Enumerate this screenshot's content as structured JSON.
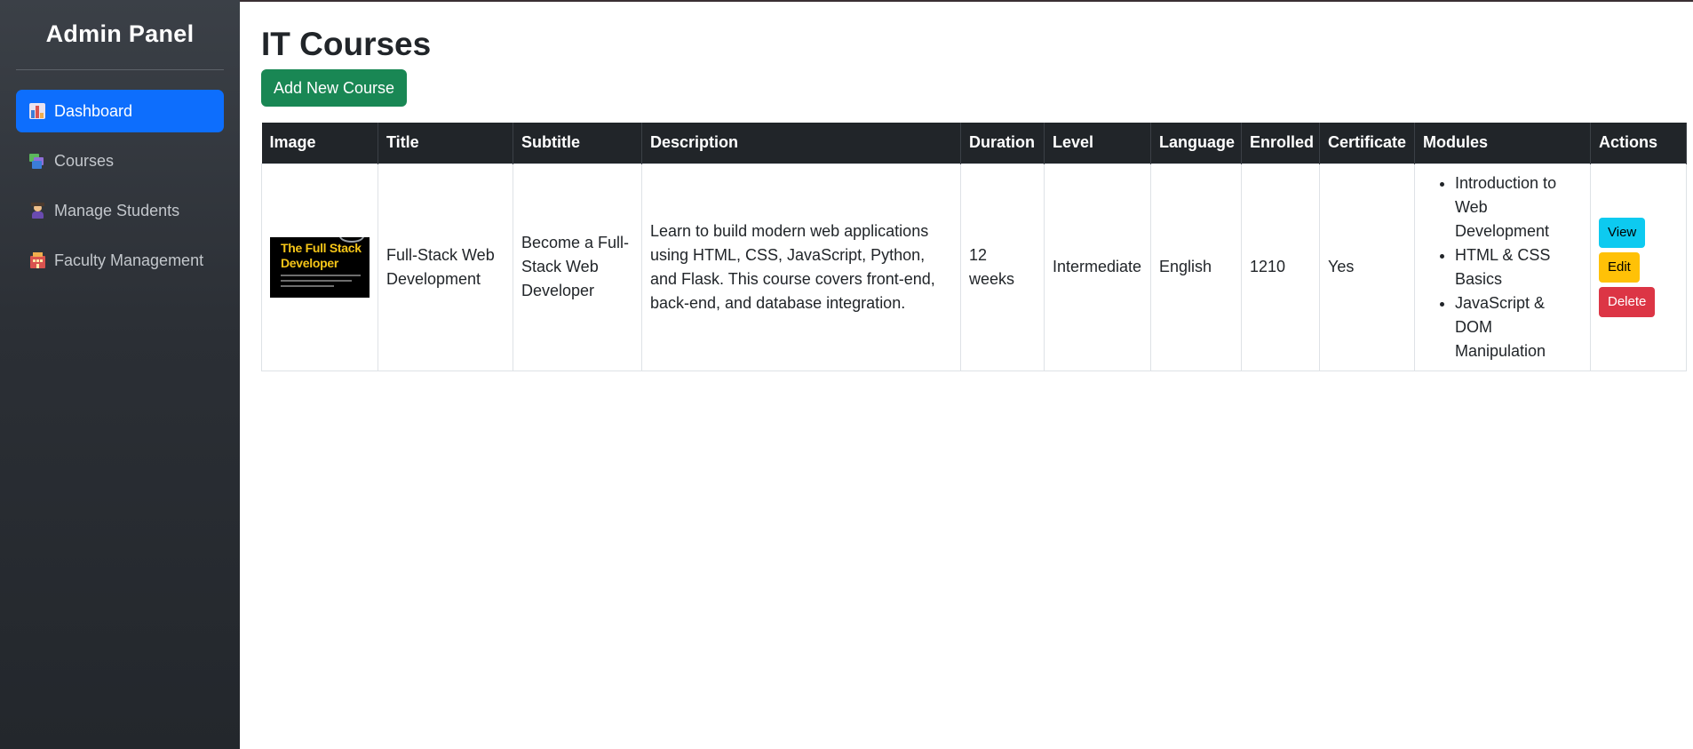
{
  "sidebar": {
    "brand": "Admin Panel",
    "items": [
      {
        "label": "Dashboard",
        "icon": "bar-chart-icon",
        "active": true
      },
      {
        "label": "Courses",
        "icon": "books-icon",
        "active": false
      },
      {
        "label": "Manage Students",
        "icon": "student-icon",
        "active": false
      },
      {
        "label": "Faculty Management",
        "icon": "school-building-icon",
        "active": false
      }
    ]
  },
  "main": {
    "title": "IT Courses",
    "add_button": "Add New Course"
  },
  "table": {
    "headers": [
      "Image",
      "Title",
      "Subtitle",
      "Description",
      "Duration",
      "Level",
      "Language",
      "Enrolled",
      "Certificate",
      "Modules",
      "Actions"
    ],
    "rows": [
      {
        "image_text": "The Full Stack Developer",
        "title": "Full-Stack Web Development",
        "subtitle": "Become a Full-Stack Web Developer",
        "description": "Learn to build modern web applications using HTML, CSS, JavaScript, Python, and Flask. This course covers front-end, back-end, and database integration.",
        "duration": "12 weeks",
        "level": "Intermediate",
        "language": "English",
        "enrolled": "1210",
        "certificate": "Yes",
        "modules": [
          "Introduction to Web Development",
          "HTML & CSS Basics",
          "JavaScript & DOM Manipulation"
        ],
        "actions": {
          "view": "View",
          "edit": "Edit",
          "delete": "Delete"
        }
      }
    ]
  },
  "colors": {
    "primary": "#0d6efd",
    "success": "#198754",
    "info": "#0dcaf0",
    "warning": "#ffc107",
    "danger": "#dc3545",
    "dark": "#212529"
  }
}
